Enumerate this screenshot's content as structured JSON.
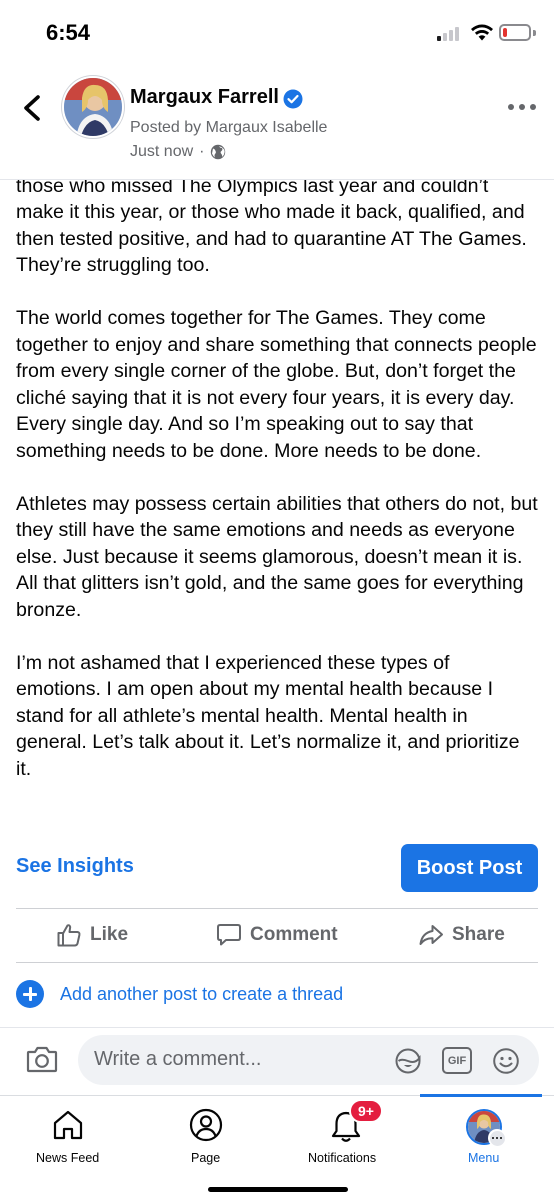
{
  "status_bar": {
    "time": "6:54"
  },
  "post": {
    "author": "Margaux Farrell",
    "posted_by": "Posted by Margaux Isabelle",
    "timestamp": "Just now",
    "separator": "·",
    "paragraphs": [
      "those who missed The Olympics last year and couldn’t make it this year, or those who made it back, qualified, and then tested positive, and had to quarantine AT The Games. They’re struggling too.",
      "The world comes together for The Games. They come together to enjoy and share something that connects people from every single corner of the globe. But, don’t forget the cliché saying that it is not every four years, it is every day. Every single day. And so I’m speaking out to say that something needs to be done. More needs to be done.",
      "Athletes may possess certain abilities that others do not, but they still have the same emotions and needs as everyone else. Just because it seems glamorous, doesn’t mean it is. All that glitters isn’t gold, and the same goes for everything bronze.",
      "I’m not ashamed that I experienced these types of emotions. I am open about my mental health because I stand for all athlete’s mental health. Mental health in general. Let’s talk about it. Let’s normalize it, and prioritize it."
    ]
  },
  "post_actions": {
    "see_insights": "See Insights",
    "boost_post": "Boost Post"
  },
  "reactions": {
    "like": "Like",
    "comment": "Comment",
    "share": "Share"
  },
  "thread": {
    "label": "Add another post to create a thread"
  },
  "comment_bar": {
    "placeholder": "Write a comment...",
    "gif_label": "GIF"
  },
  "tab_bar": {
    "items": [
      {
        "label": "News Feed",
        "icon": "home-icon"
      },
      {
        "label": "Page",
        "icon": "page-profile-icon"
      },
      {
        "label": "Notifications",
        "icon": "bell-icon",
        "badge": "9+"
      },
      {
        "label": "Menu",
        "icon": "menu-avatar-icon",
        "active": true
      }
    ]
  },
  "colors": {
    "accent": "#1b74e4",
    "text": "#050505",
    "secondary_text": "#65676b",
    "badge": "#e41e3f"
  }
}
